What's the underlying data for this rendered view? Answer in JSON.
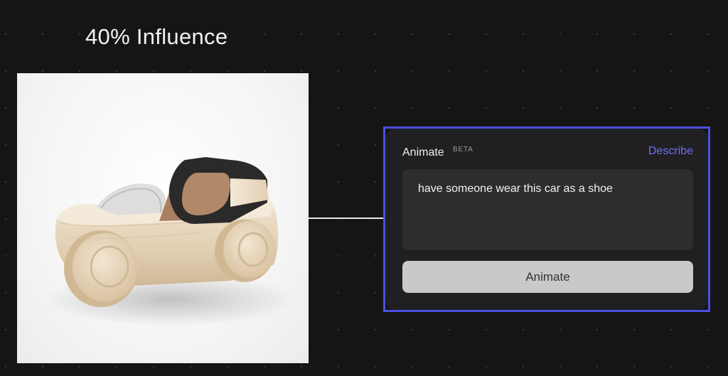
{
  "influence_label": "40% Influence",
  "image": {
    "subject": "wooden toy car"
  },
  "node": {
    "title": "Animate",
    "badge": "BETA",
    "describe_link": "Describe",
    "prompt_text": "have someone wear this car as a shoe",
    "button_label": "Animate"
  },
  "colors": {
    "background": "#161516",
    "accent": "#4b4fe0",
    "link": "#6c6ff5",
    "node_bg": "#202022",
    "input_bg": "#2d2d30",
    "button_bg": "#c9c9ca"
  }
}
